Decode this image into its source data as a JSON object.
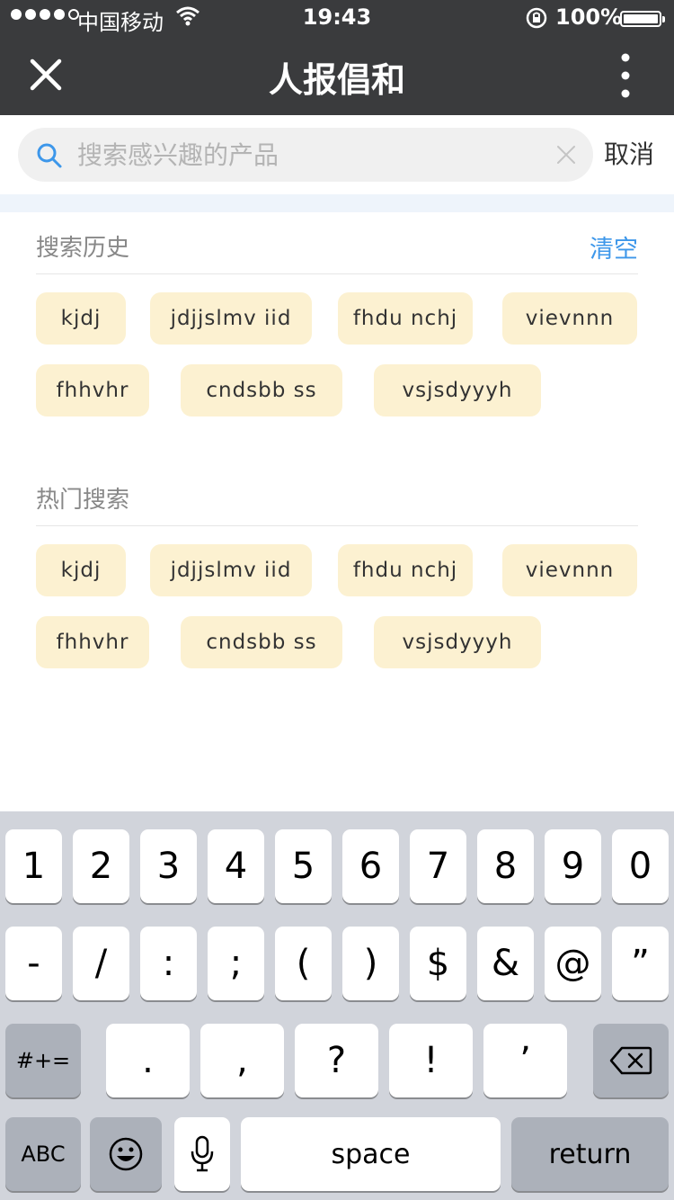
{
  "status_bar": {
    "carrier": "中国移动",
    "time": "19:43",
    "battery": "100%",
    "battery_level": 1.0
  },
  "nav": {
    "title": "人报倡和",
    "close_icon": "close-icon",
    "more_icon": "more-vertical-icon"
  },
  "search": {
    "placeholder": "搜索感兴趣的产品",
    "cancel_label": "取消",
    "accent_color": "#3d97ea"
  },
  "history": {
    "title": "搜索历史",
    "clear_label": "清空",
    "tags": [
      "kjdj",
      "jdjjslmv iid",
      "fhdu nchj",
      "vievnnn",
      "fhhvhr",
      "cndsbb ss",
      "vsjsdyyyh"
    ]
  },
  "hot": {
    "title": "热门搜索",
    "tags": [
      "kjdj",
      "jdjjslmv iid",
      "fhdu nchj",
      "vievnnn",
      "fhhvhr",
      "cndsbb ss",
      "vsjsdyyyh"
    ]
  },
  "keyboard": {
    "row1": [
      "1",
      "2",
      "3",
      "4",
      "5",
      "6",
      "7",
      "8",
      "9",
      "0"
    ],
    "row2": [
      "-",
      "/",
      ":",
      ";",
      "(",
      ")",
      "$",
      "&",
      "@",
      "”"
    ],
    "row3": {
      "symbols_label": "#+=",
      "keys": [
        ".",
        ",",
        "?",
        "!",
        "’"
      ],
      "delete_icon": "backspace-icon"
    },
    "row4": {
      "abc_label": "ABC",
      "emoji_icon": "emoji-icon",
      "mic_icon": "microphone-icon",
      "space_label": "space",
      "return_label": "return"
    }
  }
}
